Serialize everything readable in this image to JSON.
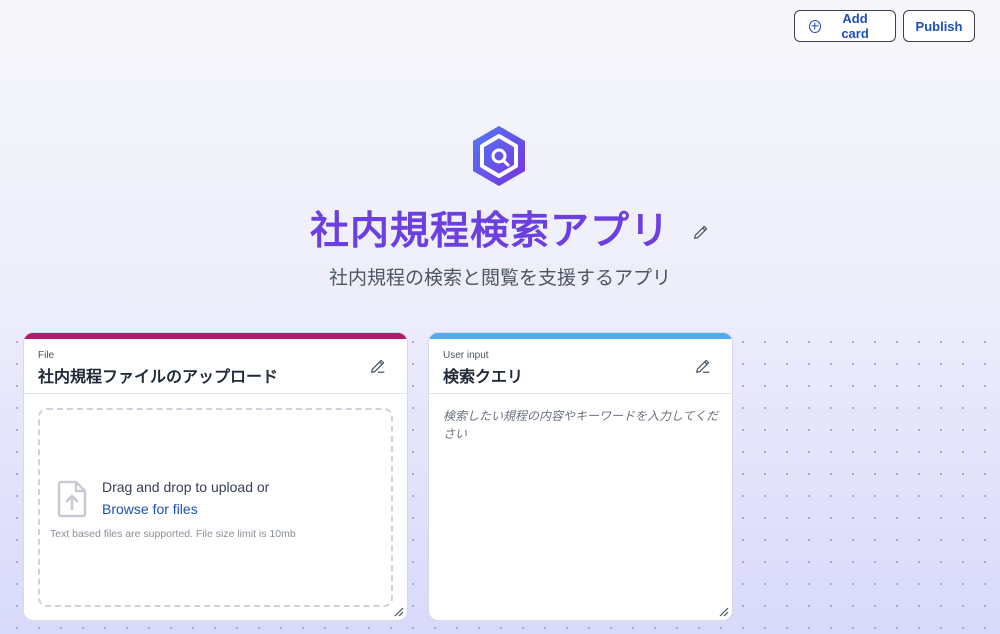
{
  "toolbar": {
    "add_card_label": "Add card",
    "publish_label": "Publish"
  },
  "app": {
    "title": "社内規程検索アプリ",
    "subtitle": "社内規程の検索と閲覧を支援するアプリ",
    "logo_icon": "app-logo-icon"
  },
  "cards": {
    "file": {
      "kind": "File",
      "title": "社内規程ファイルのアップロード",
      "accent": "#b3186f",
      "dropzone": {
        "main_text": "Drag and drop to upload or",
        "link_text": "Browse for files",
        "note": "Text based files are supported. File size limit is 10mb"
      }
    },
    "query": {
      "kind": "User input",
      "title": "検索クエリ",
      "accent": "#52aaf0",
      "placeholder": "検索したい規程の内容やキーワードを入力してください",
      "value": ""
    }
  },
  "colors": {
    "title": "#6b3fe0",
    "link": "#1e4fb8"
  }
}
